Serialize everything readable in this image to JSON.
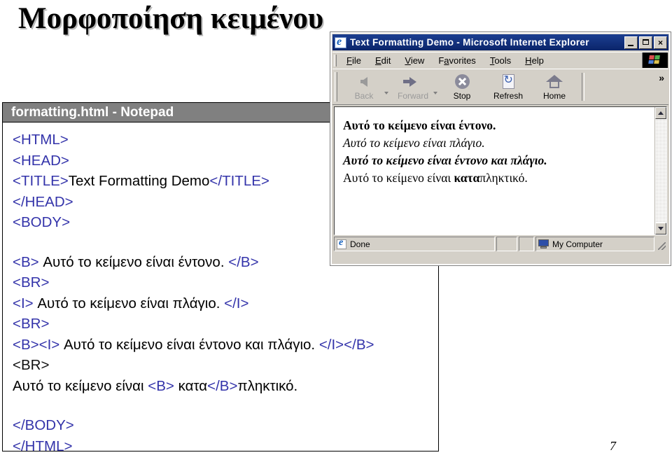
{
  "slide": {
    "title": "Μορφοποίηση κειμένου",
    "page_number": "7"
  },
  "notepad": {
    "title": "formatting.html - Notepad",
    "code_lines": [
      {
        "segments": [
          {
            "text": "<HTML>",
            "style": "tag"
          }
        ]
      },
      {
        "segments": [
          {
            "text": "<HEAD>",
            "style": "tag"
          }
        ]
      },
      {
        "segments": [
          {
            "text": "<TITLE>",
            "style": "tag"
          },
          {
            "text": "Text Formatting Demo",
            "style": "plain"
          },
          {
            "text": "</TITLE>",
            "style": "tag"
          }
        ]
      },
      {
        "segments": [
          {
            "text": "</HEAD>",
            "style": "tag"
          }
        ]
      },
      {
        "segments": [
          {
            "text": "<BODY>",
            "style": "tag"
          }
        ]
      },
      {
        "segments": []
      },
      {
        "segments": [
          {
            "text": "<B>",
            "style": "tag"
          },
          {
            "text": " Αυτό το κείμενο είναι έντονο. ",
            "style": "plain"
          },
          {
            "text": "</B>",
            "style": "tag"
          }
        ]
      },
      {
        "segments": [
          {
            "text": "<BR>",
            "style": "tag"
          }
        ]
      },
      {
        "segments": [
          {
            "text": "<I>",
            "style": "tag"
          },
          {
            "text": " Αυτό το κείμενο είναι πλάγιο. ",
            "style": "plain"
          },
          {
            "text": "</I>",
            "style": "tag"
          }
        ]
      },
      {
        "segments": [
          {
            "text": "<BR>",
            "style": "tag"
          }
        ]
      },
      {
        "segments": [
          {
            "text": "<B><I>",
            "style": "tag"
          },
          {
            "text": " Αυτό το κείμενο είναι έντονο και πλάγιο. ",
            "style": "plain"
          },
          {
            "text": "</I></B>",
            "style": "tag"
          }
        ]
      },
      {
        "segments": [
          {
            "text": "<BR>",
            "style": "tag-black"
          }
        ]
      },
      {
        "segments": [
          {
            "text": "Αυτό το κείμενο είναι ",
            "style": "plain"
          },
          {
            "text": "<B>",
            "style": "tag"
          },
          {
            "text": " κατα",
            "style": "plain"
          },
          {
            "text": "</B>",
            "style": "tag"
          },
          {
            "text": "πληκτικό.",
            "style": "plain"
          }
        ]
      },
      {
        "segments": []
      },
      {
        "segments": [
          {
            "text": "</BODY>",
            "style": "tag"
          }
        ]
      },
      {
        "segments": [
          {
            "text": "</HTML>",
            "style": "tag"
          }
        ]
      }
    ]
  },
  "browser": {
    "title": "Text Formatting Demo - Microsoft Internet Explorer",
    "window_controls": {
      "minimize": "",
      "maximize": "",
      "close": "×"
    },
    "menu": [
      {
        "accel": "F",
        "rest": "ile"
      },
      {
        "accel": "E",
        "rest": "dit"
      },
      {
        "accel": "V",
        "rest": "iew"
      },
      {
        "pre": "F",
        "accel": "a",
        "rest": "vorites"
      },
      {
        "accel": "T",
        "rest": "ools"
      },
      {
        "accel": "H",
        "rest": "elp"
      }
    ],
    "toolbar": [
      {
        "label": "Back",
        "icon": "back-arrow-icon",
        "disabled": true,
        "has_caret": true
      },
      {
        "label": "Forward",
        "icon": "forward-arrow-icon",
        "disabled": true,
        "has_caret": true
      },
      {
        "label": "Stop",
        "icon": "stop-icon",
        "disabled": false,
        "has_caret": false
      },
      {
        "label": "Refresh",
        "icon": "refresh-icon",
        "disabled": false,
        "has_caret": false
      },
      {
        "label": "Home",
        "icon": "home-icon",
        "disabled": false,
        "has_caret": false
      }
    ],
    "toolbar_overflow": "»",
    "content_lines": [
      {
        "text": "Αυτό το κείμενο είναι έντονο.",
        "style": "bold"
      },
      {
        "text": "Αυτό το κείμενο είναι πλάγιο.",
        "style": "italic"
      },
      {
        "text": "Αυτό το κείμενο είναι έντονο και πλάγιο.",
        "style": "bolditalic"
      },
      {
        "style": "mixed",
        "parts": [
          {
            "text": "Αυτό το κείμενο είναι ",
            "style": "normal"
          },
          {
            "text": "κατα",
            "style": "bold"
          },
          {
            "text": "πληκτικό.",
            "style": "normal"
          }
        ]
      }
    ],
    "status": {
      "left": "Done",
      "zone": "My Computer"
    }
  },
  "colors": {
    "tag_blue": "#3333aa",
    "titlebar_blue": "#0a246a",
    "notepad_gray": "#808080",
    "chrome_gray": "#d4d0c8"
  }
}
